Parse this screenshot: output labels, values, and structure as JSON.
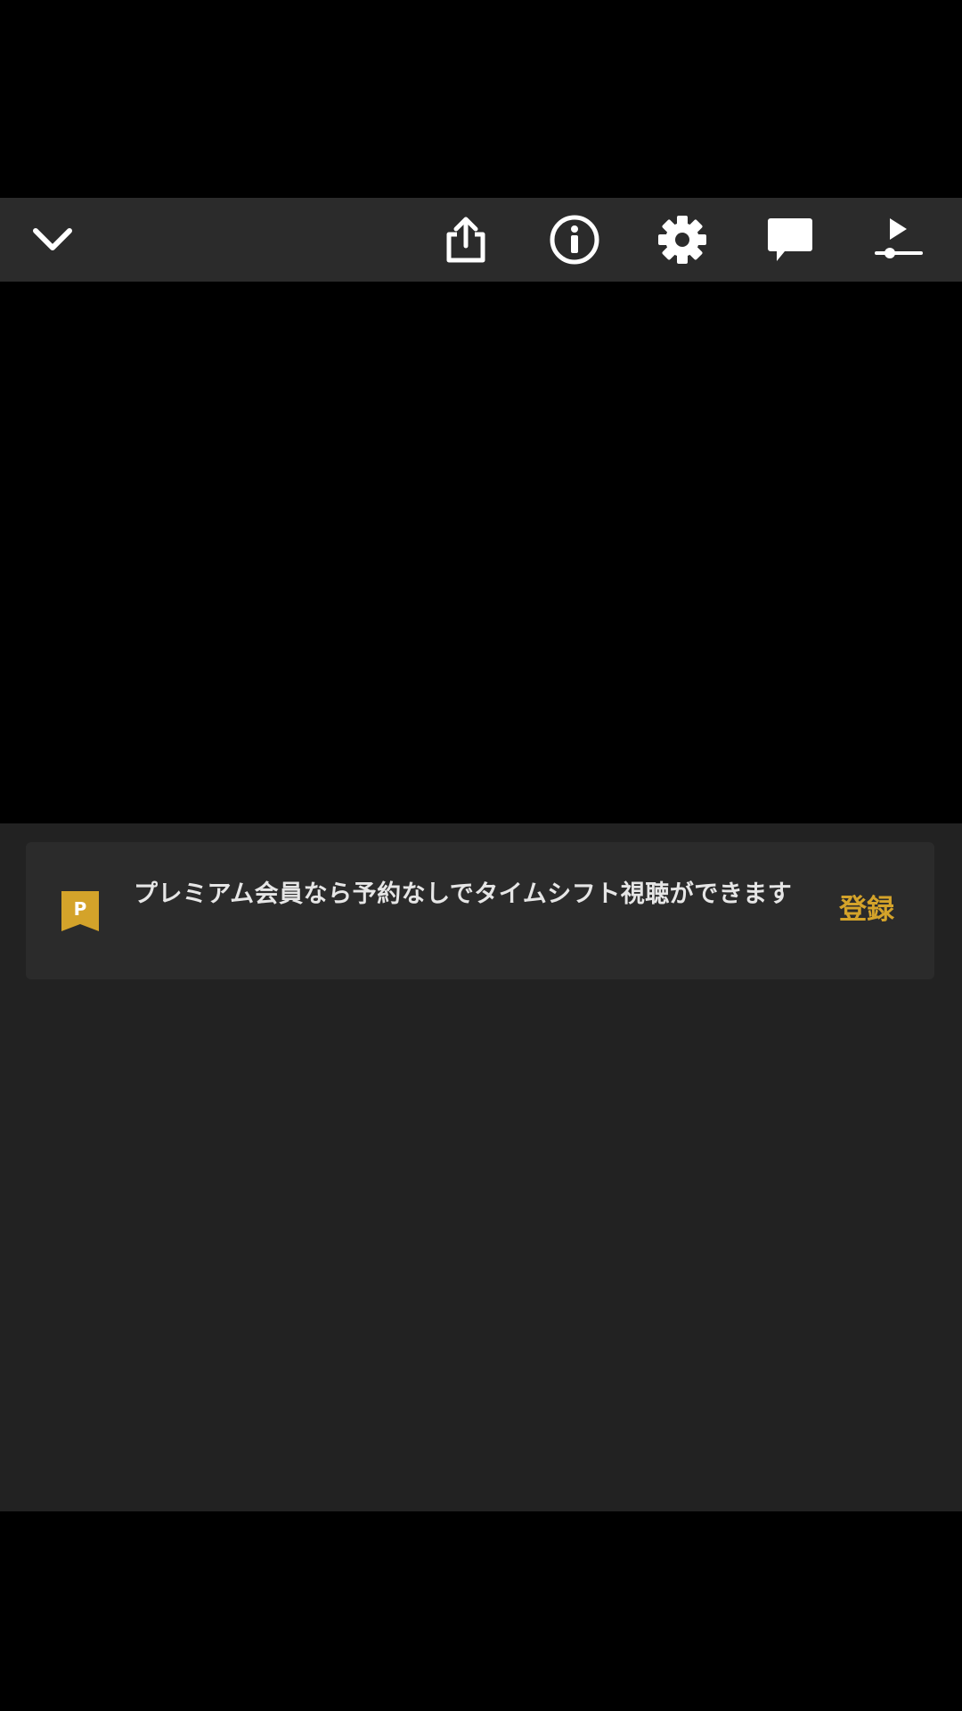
{
  "toolbar": {
    "buttons": [
      {
        "name": "collapse",
        "icon": "chevron-down-icon"
      },
      {
        "name": "share",
        "icon": "share-icon"
      },
      {
        "name": "info",
        "icon": "info-icon"
      },
      {
        "name": "settings",
        "icon": "gear-icon"
      },
      {
        "name": "comments",
        "icon": "comment-icon"
      },
      {
        "name": "playback",
        "icon": "play-slider-icon"
      }
    ],
    "icon_color": "#ffffff",
    "background": "#2b2b2b"
  },
  "premium_banner": {
    "badge_letter": "P",
    "badge_icon": "premium-bookmark-icon",
    "badge_color": "#d4a32a",
    "message": "プレミアム会員なら予約なしでタイムシフト視聴ができます",
    "register_label": "登録",
    "accent_color": "#d4a32a"
  }
}
